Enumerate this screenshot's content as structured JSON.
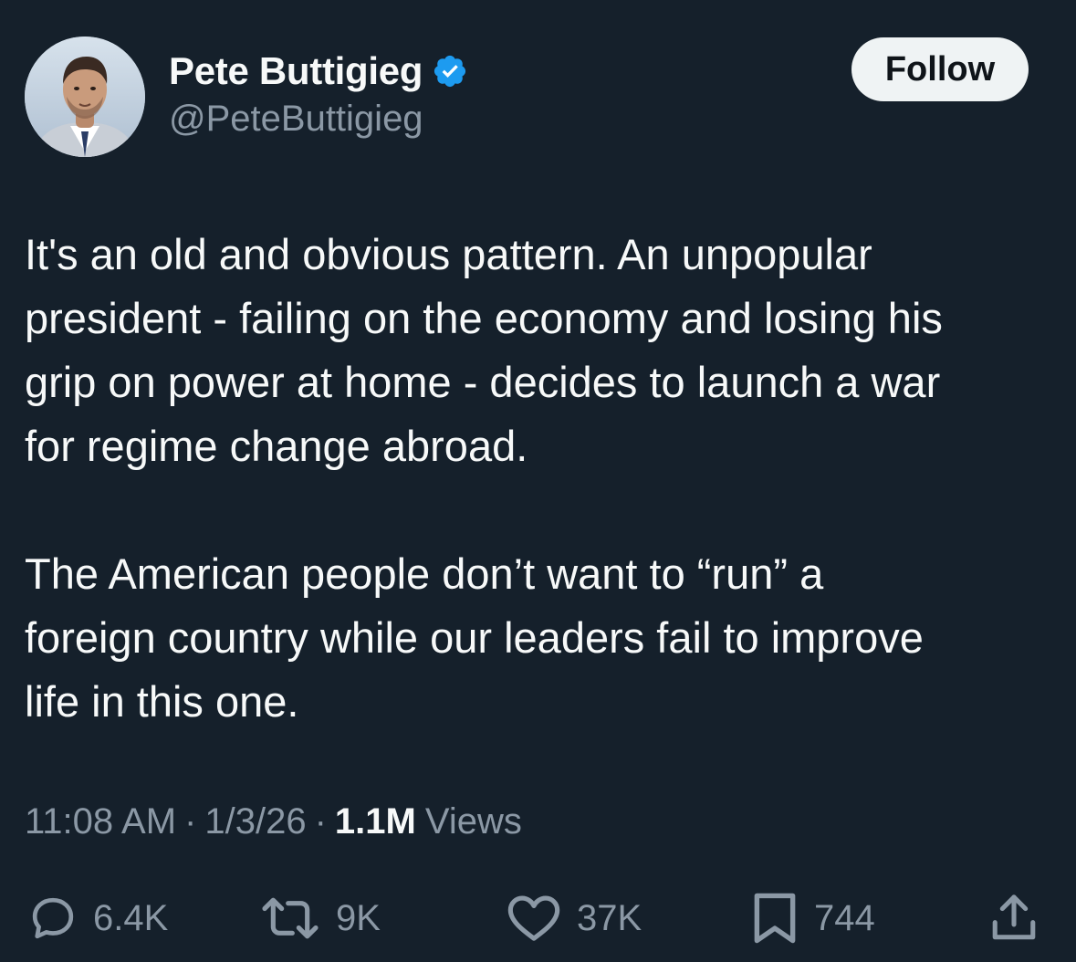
{
  "author": {
    "display_name": "Pete Buttigieg",
    "handle": "@PeteButtigieg",
    "verified": true
  },
  "follow_label": "Follow",
  "tweet": {
    "paragraphs": [
      "It's an old and obvious pattern. An unpopular\npresident - failing on the economy and losing his\ngrip on power at home - decides to launch a war\nfor regime change abroad.",
      "The American people don’t want to “run” a\nforeign country while our leaders fail to improve\nlife in this one."
    ]
  },
  "meta": {
    "time": "11:08 AM",
    "separator": "·",
    "date": "1/3/26",
    "views_count": "1.1M",
    "views_label": "Views"
  },
  "actions": {
    "replies": "6.4K",
    "reposts": "9K",
    "likes": "37K",
    "bookmarks": "744"
  },
  "colors": {
    "background": "#15202b",
    "text": "#f7f9f9",
    "secondary": "#8b98a5",
    "verified": "#1d9bf0",
    "follow_bg": "#eff3f4"
  },
  "icons": {
    "reply": "speech-bubble-icon",
    "repost": "repost-arrows-icon",
    "like": "heart-icon",
    "bookmark": "bookmark-icon",
    "share": "share-upload-icon",
    "verified": "verified-badge-icon"
  }
}
